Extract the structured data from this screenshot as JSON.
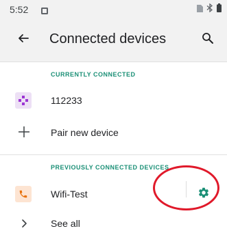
{
  "status_bar": {
    "time": "5:52"
  },
  "app_bar": {
    "title": "Connected devices"
  },
  "sections": {
    "current": {
      "header": "CURRENTLY CONNECTED",
      "device_name": "112233"
    },
    "pair": {
      "label": "Pair new device"
    },
    "previous": {
      "header": "PREVIOUSLY CONNECTED DEVICES",
      "device_name": "Wifi-Test"
    },
    "see_all": {
      "label": "See all"
    }
  },
  "colors": {
    "accent": "#1a8f76",
    "gamepad_bg": "#ede0f5",
    "gamepad": "#9c35d4",
    "phone_bg": "#fde4d2",
    "phone": "#e8710a",
    "annotation": "#e0192a"
  },
  "icons": {
    "back": "arrow-back-icon",
    "search": "search-icon",
    "current_device": "gamepad-icon",
    "pair": "plus-icon",
    "previous_device": "phone-icon",
    "settings": "gear-icon",
    "see_all": "chevron-right-icon"
  }
}
